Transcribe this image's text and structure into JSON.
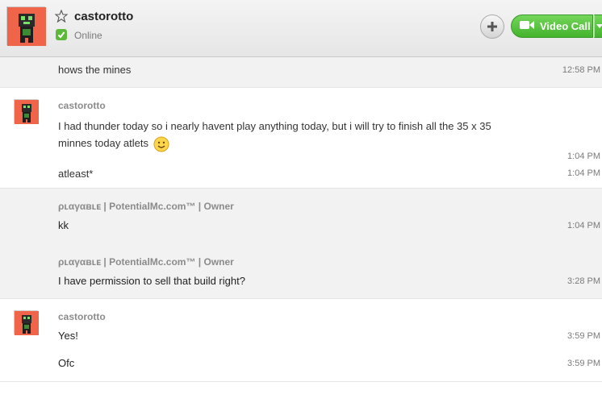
{
  "header": {
    "contact_name": "castorotto",
    "status": "Online",
    "video_call_label": "Video Call"
  },
  "messages": {
    "m1": {
      "text": "hows the mines",
      "time": "12:58 PM"
    },
    "g2": {
      "sender": "castorotto",
      "m1_text": "I had thunder today so i nearly havent play anything today, but i will try to finish all the 35 x 35 minnes today atlets",
      "m1_line1": "I had thunder today so i nearly havent play anything today, but i will try to finish all the 35 x 35",
      "m1_line2": "minnes today atlets",
      "m1_time": "1:04 PM",
      "m2_text": "atleast*",
      "m2_time": "1:04 PM"
    },
    "g3": {
      "sender": "ρʟαγαʙʟᴇ | PotentialMc.com™ | Owner",
      "text": "kk",
      "time": "1:04 PM"
    },
    "g4": {
      "sender": "ρʟαγαʙʟᴇ | PotentialMc.com™ | Owner",
      "text": "I have permission to sell that build right?",
      "time": "3:28 PM"
    },
    "g5": {
      "sender": "castorotto",
      "m1_text": "Yes!",
      "m1_time": "3:59 PM",
      "m2_text": "Ofc",
      "m2_time": "3:59 PM"
    }
  },
  "colors": {
    "avatar_bg": "#f0654a",
    "online_green": "#5cb83a",
    "video_green": "#4cbf35"
  },
  "icons": [
    "star-icon",
    "online-status-icon",
    "plus-icon",
    "video-camera-icon",
    "chevron-down-icon",
    "smiley-icon"
  ]
}
